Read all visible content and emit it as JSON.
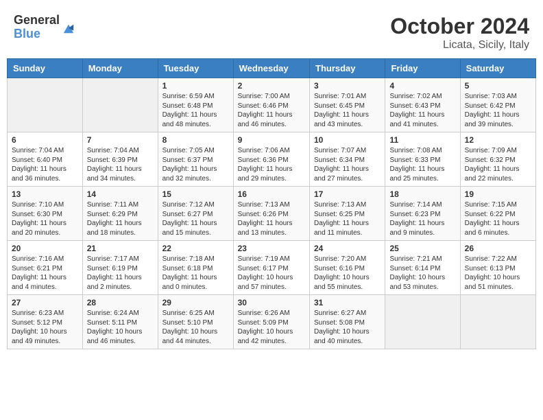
{
  "header": {
    "logo_line1": "General",
    "logo_line2": "Blue",
    "month_title": "October 2024",
    "subtitle": "Licata, Sicily, Italy"
  },
  "weekdays": [
    "Sunday",
    "Monday",
    "Tuesday",
    "Wednesday",
    "Thursday",
    "Friday",
    "Saturday"
  ],
  "weeks": [
    [
      {
        "day": "",
        "info": ""
      },
      {
        "day": "",
        "info": ""
      },
      {
        "day": "1",
        "info": "Sunrise: 6:59 AM\nSunset: 6:48 PM\nDaylight: 11 hours and 48 minutes."
      },
      {
        "day": "2",
        "info": "Sunrise: 7:00 AM\nSunset: 6:46 PM\nDaylight: 11 hours and 46 minutes."
      },
      {
        "day": "3",
        "info": "Sunrise: 7:01 AM\nSunset: 6:45 PM\nDaylight: 11 hours and 43 minutes."
      },
      {
        "day": "4",
        "info": "Sunrise: 7:02 AM\nSunset: 6:43 PM\nDaylight: 11 hours and 41 minutes."
      },
      {
        "day": "5",
        "info": "Sunrise: 7:03 AM\nSunset: 6:42 PM\nDaylight: 11 hours and 39 minutes."
      }
    ],
    [
      {
        "day": "6",
        "info": "Sunrise: 7:04 AM\nSunset: 6:40 PM\nDaylight: 11 hours and 36 minutes."
      },
      {
        "day": "7",
        "info": "Sunrise: 7:04 AM\nSunset: 6:39 PM\nDaylight: 11 hours and 34 minutes."
      },
      {
        "day": "8",
        "info": "Sunrise: 7:05 AM\nSunset: 6:37 PM\nDaylight: 11 hours and 32 minutes."
      },
      {
        "day": "9",
        "info": "Sunrise: 7:06 AM\nSunset: 6:36 PM\nDaylight: 11 hours and 29 minutes."
      },
      {
        "day": "10",
        "info": "Sunrise: 7:07 AM\nSunset: 6:34 PM\nDaylight: 11 hours and 27 minutes."
      },
      {
        "day": "11",
        "info": "Sunrise: 7:08 AM\nSunset: 6:33 PM\nDaylight: 11 hours and 25 minutes."
      },
      {
        "day": "12",
        "info": "Sunrise: 7:09 AM\nSunset: 6:32 PM\nDaylight: 11 hours and 22 minutes."
      }
    ],
    [
      {
        "day": "13",
        "info": "Sunrise: 7:10 AM\nSunset: 6:30 PM\nDaylight: 11 hours and 20 minutes."
      },
      {
        "day": "14",
        "info": "Sunrise: 7:11 AM\nSunset: 6:29 PM\nDaylight: 11 hours and 18 minutes."
      },
      {
        "day": "15",
        "info": "Sunrise: 7:12 AM\nSunset: 6:27 PM\nDaylight: 11 hours and 15 minutes."
      },
      {
        "day": "16",
        "info": "Sunrise: 7:13 AM\nSunset: 6:26 PM\nDaylight: 11 hours and 13 minutes."
      },
      {
        "day": "17",
        "info": "Sunrise: 7:13 AM\nSunset: 6:25 PM\nDaylight: 11 hours and 11 minutes."
      },
      {
        "day": "18",
        "info": "Sunrise: 7:14 AM\nSunset: 6:23 PM\nDaylight: 11 hours and 9 minutes."
      },
      {
        "day": "19",
        "info": "Sunrise: 7:15 AM\nSunset: 6:22 PM\nDaylight: 11 hours and 6 minutes."
      }
    ],
    [
      {
        "day": "20",
        "info": "Sunrise: 7:16 AM\nSunset: 6:21 PM\nDaylight: 11 hours and 4 minutes."
      },
      {
        "day": "21",
        "info": "Sunrise: 7:17 AM\nSunset: 6:19 PM\nDaylight: 11 hours and 2 minutes."
      },
      {
        "day": "22",
        "info": "Sunrise: 7:18 AM\nSunset: 6:18 PM\nDaylight: 11 hours and 0 minutes."
      },
      {
        "day": "23",
        "info": "Sunrise: 7:19 AM\nSunset: 6:17 PM\nDaylight: 10 hours and 57 minutes."
      },
      {
        "day": "24",
        "info": "Sunrise: 7:20 AM\nSunset: 6:16 PM\nDaylight: 10 hours and 55 minutes."
      },
      {
        "day": "25",
        "info": "Sunrise: 7:21 AM\nSunset: 6:14 PM\nDaylight: 10 hours and 53 minutes."
      },
      {
        "day": "26",
        "info": "Sunrise: 7:22 AM\nSunset: 6:13 PM\nDaylight: 10 hours and 51 minutes."
      }
    ],
    [
      {
        "day": "27",
        "info": "Sunrise: 6:23 AM\nSunset: 5:12 PM\nDaylight: 10 hours and 49 minutes."
      },
      {
        "day": "28",
        "info": "Sunrise: 6:24 AM\nSunset: 5:11 PM\nDaylight: 10 hours and 46 minutes."
      },
      {
        "day": "29",
        "info": "Sunrise: 6:25 AM\nSunset: 5:10 PM\nDaylight: 10 hours and 44 minutes."
      },
      {
        "day": "30",
        "info": "Sunrise: 6:26 AM\nSunset: 5:09 PM\nDaylight: 10 hours and 42 minutes."
      },
      {
        "day": "31",
        "info": "Sunrise: 6:27 AM\nSunset: 5:08 PM\nDaylight: 10 hours and 40 minutes."
      },
      {
        "day": "",
        "info": ""
      },
      {
        "day": "",
        "info": ""
      }
    ]
  ]
}
